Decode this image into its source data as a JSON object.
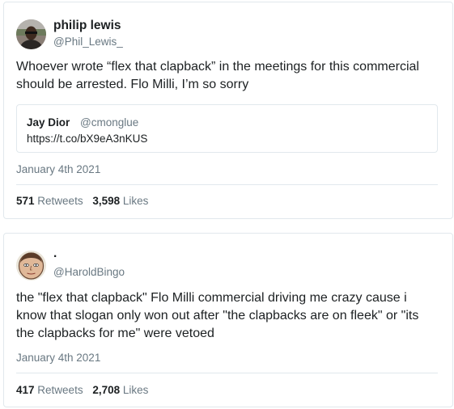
{
  "tweets": [
    {
      "author_name": "philip lewis",
      "author_handle": "@Phil_Lewis_",
      "text_lines": [
        "Whoever wrote “flex that clapback” in the meetings for this commercial",
        "should be arrested. Flo Milli, I’m so sorry"
      ],
      "quote": {
        "author_name": "Jay Dior",
        "author_handle": "@cmonglue",
        "link": "https://t.co/bX9eA3nKUS"
      },
      "date": "January 4th 2021",
      "retweets_count": "571",
      "retweets_label": "Retweets",
      "likes_count": "3,598",
      "likes_label": "Likes"
    },
    {
      "author_name": ".",
      "author_handle": "@HaroldBingo",
      "text_lines": [
        "the \"flex that clapback\" Flo Milli commercial driving me crazy cause i",
        "know that slogan only won out after \"the clapbacks are on fleek\" or \"its",
        "the clapbacks for me\" were vetoed"
      ],
      "date": "January 4th 2021",
      "retweets_count": "417",
      "retweets_label": "Retweets",
      "likes_count": "2,708",
      "likes_label": "Likes"
    }
  ]
}
